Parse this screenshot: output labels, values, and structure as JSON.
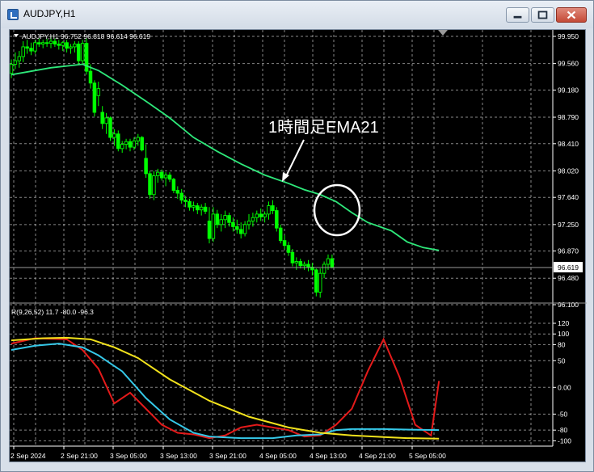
{
  "window": {
    "title": "AUDJPY,H1"
  },
  "price_panel": {
    "header": "AUDJPY,H1  96.752 96.818 96.614 96.619",
    "annotation": "1時間足EMA21",
    "current_price": "96.619",
    "y_ticks": [
      "99.950",
      "99.560",
      "99.180",
      "98.790",
      "98.410",
      "98.020",
      "97.640",
      "97.250",
      "96.870",
      "96.480",
      "96.100"
    ]
  },
  "indicator_panel": {
    "header": "R(9,26,52) 11.7 -80.0 -96.3",
    "y_ticks": [
      "120",
      "100",
      "80",
      "50",
      "0.00",
      "-50",
      "-80",
      "-100"
    ]
  },
  "x_axis": {
    "labels": [
      "2 Sep 2024",
      "2 Sep 21:00",
      "3 Sep 05:00",
      "3 Sep 13:00",
      "3 Sep 21:00",
      "4 Sep 05:00",
      "4 Sep 13:00",
      "4 Sep 21:00",
      "5 Sep 05:00"
    ]
  },
  "colors": {
    "background": "#000000",
    "grid": "#c0c0c0",
    "candle": "#00ff00",
    "ema": "#2ee87a",
    "line_red": "#e41a1a",
    "line_cyan": "#35c8e8",
    "line_yellow": "#f2e21c",
    "axis_text": "#ffffff"
  },
  "chart_data": [
    {
      "type": "candlestick",
      "y_axis_range": [
        96.1,
        99.95
      ],
      "ema_period": 21,
      "bars_ohlc": [
        [
          99.42,
          99.62,
          99.35,
          99.55
        ],
        [
          99.55,
          99.72,
          99.48,
          99.6
        ],
        [
          99.6,
          99.74,
          99.5,
          99.66
        ],
        [
          99.66,
          99.88,
          99.58,
          99.8
        ],
        [
          99.8,
          99.9,
          99.7,
          99.78
        ],
        [
          99.78,
          99.86,
          99.68,
          99.74
        ],
        [
          99.74,
          99.9,
          99.7,
          99.86
        ],
        [
          99.86,
          99.92,
          99.8,
          99.84
        ],
        [
          99.84,
          99.9,
          99.78,
          99.86
        ],
        [
          99.86,
          99.92,
          99.8,
          99.85
        ],
        [
          99.85,
          99.95,
          99.78,
          99.88
        ],
        [
          99.88,
          99.92,
          99.8,
          99.84
        ],
        [
          99.84,
          99.9,
          99.76,
          99.82
        ],
        [
          99.82,
          99.88,
          99.74,
          99.86
        ],
        [
          99.86,
          99.9,
          99.72,
          99.78
        ],
        [
          99.78,
          99.84,
          99.7,
          99.8
        ],
        [
          99.8,
          99.88,
          99.72,
          99.84
        ],
        [
          99.84,
          99.88,
          99.55,
          99.6
        ],
        [
          99.6,
          99.9,
          99.55,
          99.85
        ],
        [
          99.85,
          99.92,
          99.4,
          99.45
        ],
        [
          99.45,
          99.55,
          99.2,
          99.28
        ],
        [
          99.28,
          99.32,
          98.8,
          98.86
        ],
        [
          99.1,
          99.3,
          98.95,
          99.2
        ],
        [
          98.86,
          98.95,
          98.62,
          98.7
        ],
        [
          98.7,
          98.85,
          98.55,
          98.78
        ],
        [
          98.78,
          98.8,
          98.45,
          98.5
        ],
        [
          98.5,
          98.62,
          98.38,
          98.55
        ],
        [
          98.55,
          98.6,
          98.3,
          98.34
        ],
        [
          98.34,
          98.45,
          98.28,
          98.4
        ],
        [
          98.4,
          98.48,
          98.33,
          98.44
        ],
        [
          98.44,
          98.48,
          98.3,
          98.36
        ],
        [
          98.36,
          98.5,
          98.32,
          98.45
        ],
        [
          98.45,
          98.55,
          98.38,
          98.5
        ],
        [
          98.5,
          98.52,
          98.3,
          98.32
        ],
        [
          98.2,
          98.4,
          97.92,
          97.98
        ],
        [
          97.98,
          98.02,
          97.62,
          97.68
        ],
        [
          97.68,
          98.02,
          97.6,
          97.95
        ],
        [
          97.95,
          98.05,
          97.85,
          98.0
        ],
        [
          98.0,
          98.04,
          97.88,
          97.92
        ],
        [
          97.92,
          98.0,
          97.8,
          97.96
        ],
        [
          97.96,
          98.0,
          97.86,
          97.9
        ],
        [
          97.9,
          97.92,
          97.7,
          97.74
        ],
        [
          97.74,
          97.8,
          97.62,
          97.7
        ],
        [
          97.7,
          97.76,
          97.55,
          97.6
        ],
        [
          97.6,
          97.66,
          97.5,
          97.58
        ],
        [
          97.58,
          97.62,
          97.45,
          97.5
        ],
        [
          97.5,
          97.58,
          97.44,
          97.52
        ],
        [
          97.52,
          97.56,
          97.4,
          97.46
        ],
        [
          97.46,
          97.54,
          97.38,
          97.5
        ],
        [
          97.5,
          97.56,
          97.4,
          97.44
        ],
        [
          97.3,
          97.5,
          96.98,
          97.05
        ],
        [
          97.05,
          97.5,
          97.0,
          97.4
        ],
        [
          97.4,
          97.46,
          97.2,
          97.25
        ],
        [
          97.25,
          97.4,
          97.15,
          97.32
        ],
        [
          97.32,
          97.45,
          97.2,
          97.38
        ],
        [
          97.38,
          97.42,
          97.22,
          97.28
        ],
        [
          97.28,
          97.35,
          97.15,
          97.22
        ],
        [
          97.22,
          97.32,
          97.12,
          97.18
        ],
        [
          97.18,
          97.28,
          97.05,
          97.12
        ],
        [
          97.12,
          97.3,
          97.08,
          97.25
        ],
        [
          97.25,
          97.4,
          97.18,
          97.3
        ],
        [
          97.3,
          97.42,
          97.22,
          97.35
        ],
        [
          97.35,
          97.45,
          97.28,
          97.4
        ],
        [
          97.4,
          97.48,
          97.3,
          97.36
        ],
        [
          97.36,
          97.44,
          97.28,
          97.4
        ],
        [
          97.4,
          97.58,
          97.32,
          97.52
        ],
        [
          97.52,
          97.6,
          97.4,
          97.45
        ],
        [
          97.45,
          97.5,
          97.15,
          97.2
        ],
        [
          97.2,
          97.25,
          96.98,
          97.02
        ],
        [
          97.02,
          97.1,
          96.9,
          96.95
        ],
        [
          96.95,
          97.0,
          96.8,
          96.85
        ],
        [
          96.85,
          96.9,
          96.65,
          96.7
        ],
        [
          96.7,
          96.78,
          96.6,
          96.72
        ],
        [
          96.72,
          96.76,
          96.62,
          96.66
        ],
        [
          96.66,
          96.72,
          96.6,
          96.68
        ],
        [
          96.68,
          96.74,
          96.58,
          96.64
        ],
        [
          96.64,
          96.7,
          96.52,
          96.6
        ],
        [
          96.6,
          96.62,
          96.22,
          96.28
        ],
        [
          96.28,
          96.62,
          96.2,
          96.55
        ],
        [
          96.55,
          96.72,
          96.48,
          96.68
        ],
        [
          96.68,
          96.82,
          96.6,
          96.76
        ],
        [
          96.76,
          96.82,
          96.62,
          96.64
        ]
      ],
      "ema": [
        [
          0,
          99.4
        ],
        [
          10,
          99.5
        ],
        [
          18,
          99.55
        ],
        [
          22,
          99.46
        ],
        [
          28,
          99.25
        ],
        [
          34,
          99.02
        ],
        [
          40,
          98.78
        ],
        [
          46,
          98.5
        ],
        [
          52,
          98.3
        ],
        [
          58,
          98.12
        ],
        [
          64,
          97.96
        ],
        [
          70,
          97.84
        ],
        [
          74,
          97.75
        ],
        [
          78,
          97.68
        ],
        [
          82,
          97.58
        ],
        [
          86,
          97.42
        ],
        [
          90,
          97.28
        ],
        [
          96,
          97.16
        ],
        [
          100,
          97.0
        ],
        [
          104,
          96.92
        ],
        [
          108,
          96.88
        ]
      ]
    },
    {
      "type": "line",
      "y_axis_range": [
        -110,
        120
      ],
      "series": [
        {
          "values": [
            [
              0,
              82
            ],
            [
              6,
              92
            ],
            [
              14,
              90
            ],
            [
              18,
              70
            ],
            [
              22,
              35
            ],
            [
              26,
              -30
            ],
            [
              30,
              -10
            ],
            [
              34,
              -40
            ],
            [
              38,
              -70
            ],
            [
              42,
              -85
            ],
            [
              46,
              -88
            ],
            [
              50,
              -95
            ],
            [
              54,
              -90
            ],
            [
              58,
              -75
            ],
            [
              62,
              -70
            ],
            [
              66,
              -75
            ],
            [
              70,
              -80
            ],
            [
              74,
              -92
            ],
            [
              78,
              -90
            ],
            [
              82,
              -70
            ],
            [
              86,
              -40
            ],
            [
              90,
              30
            ],
            [
              94,
              90
            ],
            [
              98,
              20
            ],
            [
              102,
              -70
            ],
            [
              106,
              -90
            ],
            [
              108,
              12
            ]
          ]
        },
        {
          "values": [
            [
              0,
              70
            ],
            [
              6,
              78
            ],
            [
              12,
              82
            ],
            [
              18,
              75
            ],
            [
              22,
              60
            ],
            [
              28,
              30
            ],
            [
              34,
              -20
            ],
            [
              40,
              -60
            ],
            [
              46,
              -85
            ],
            [
              50,
              -92
            ],
            [
              58,
              -95
            ],
            [
              66,
              -95
            ],
            [
              72,
              -90
            ],
            [
              78,
              -88
            ],
            [
              82,
              -80
            ],
            [
              86,
              -78
            ],
            [
              94,
              -78
            ],
            [
              100,
              -79
            ],
            [
              108,
              -80
            ]
          ]
        },
        {
          "values": [
            [
              0,
              88
            ],
            [
              8,
              92
            ],
            [
              14,
              93
            ],
            [
              20,
              90
            ],
            [
              26,
              75
            ],
            [
              32,
              55
            ],
            [
              40,
              15
            ],
            [
              50,
              -25
            ],
            [
              60,
              -55
            ],
            [
              70,
              -75
            ],
            [
              78,
              -85
            ],
            [
              86,
              -90
            ],
            [
              94,
              -93
            ],
            [
              100,
              -95
            ],
            [
              108,
              -96
            ]
          ]
        }
      ]
    }
  ]
}
